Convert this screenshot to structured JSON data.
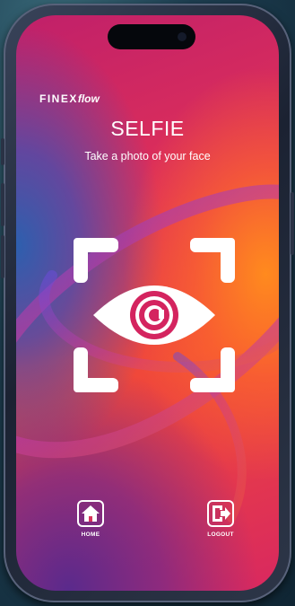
{
  "brand": {
    "logo_main": "FINEX",
    "logo_accent": "flow"
  },
  "screen": {
    "title": "SELFIE",
    "subtitle": "Take a photo of your face"
  },
  "scanner": {
    "icon": "eye-scan-icon"
  },
  "nav": {
    "home": {
      "label": "HOME",
      "icon": "home-icon"
    },
    "logout": {
      "label": "LOGOUT",
      "icon": "logout-icon"
    }
  },
  "colors": {
    "gradient_pink": "#e03058",
    "gradient_orange": "#ff8a1e",
    "gradient_blue": "#2d5fae",
    "gradient_purple": "#5a2a8c",
    "eye_ring": "#d4245f",
    "text": "#ffffff"
  }
}
